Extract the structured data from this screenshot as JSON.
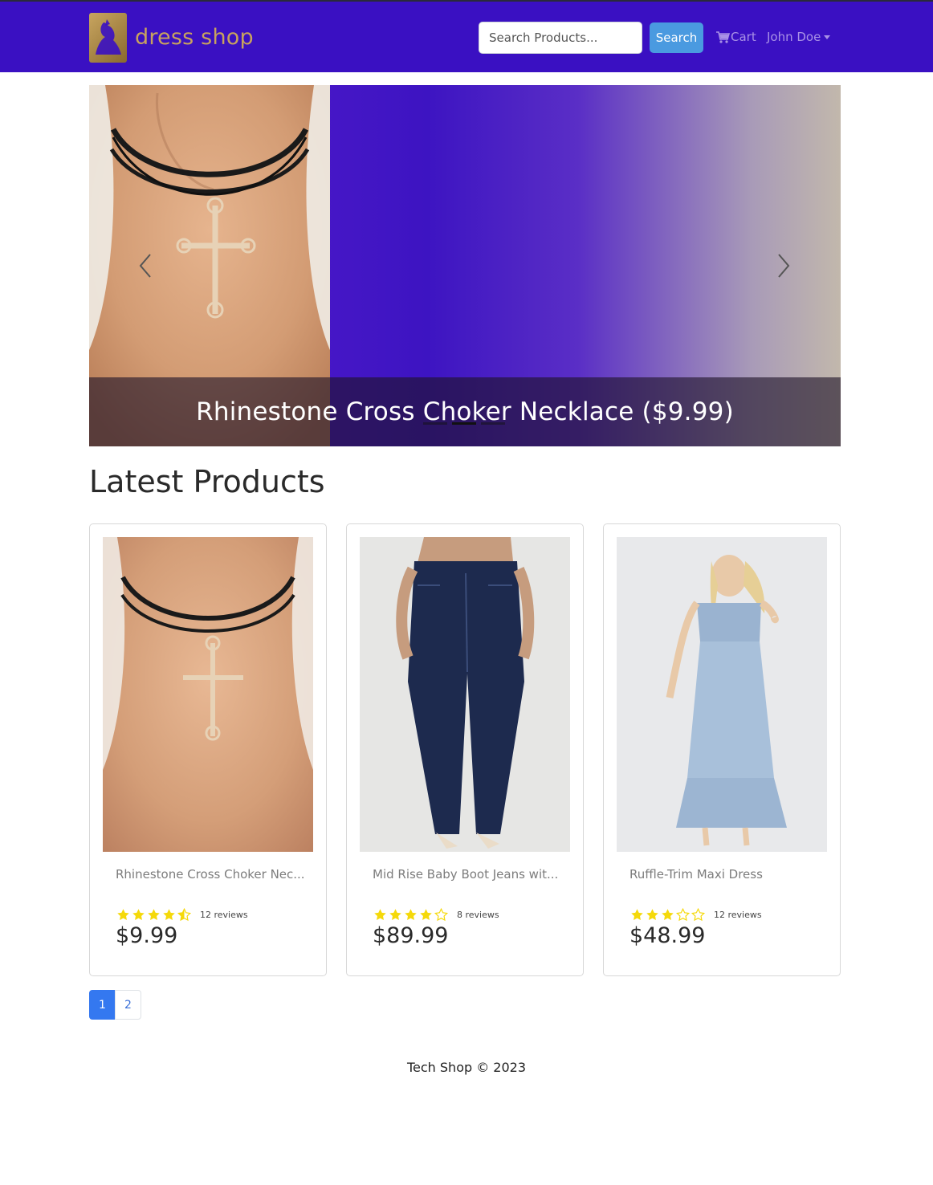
{
  "navbar": {
    "brand_text": "dress shop",
    "search_placeholder": "Search Products...",
    "search_button": "Search",
    "cart_label": "Cart",
    "user_name": "John Doe"
  },
  "carousel": {
    "caption": "Rhinestone Cross Choker Necklace ($9.99)",
    "indicator_count": 3,
    "active_index": 1
  },
  "section_title": "Latest Products",
  "products": [
    {
      "name": "Rhinestone Cross Choker Nec...",
      "rating": 4.5,
      "reviews": "12 reviews",
      "price": "$9.99"
    },
    {
      "name": "Mid Rise Baby Boot Jeans wit...",
      "rating": 4,
      "reviews": "8 reviews",
      "price": "$89.99"
    },
    {
      "name": "Ruffle-Trim Maxi Dress",
      "rating": 3,
      "reviews": "12 reviews",
      "price": "$48.99"
    }
  ],
  "pagination": {
    "pages": [
      "1",
      "2"
    ],
    "active": "1"
  },
  "footer": "Tech Shop © 2023",
  "colors": {
    "navbar": "#3a10c2",
    "accent": "#4a9ae0",
    "star": "#f5d90a",
    "page_active": "#3478f0"
  }
}
